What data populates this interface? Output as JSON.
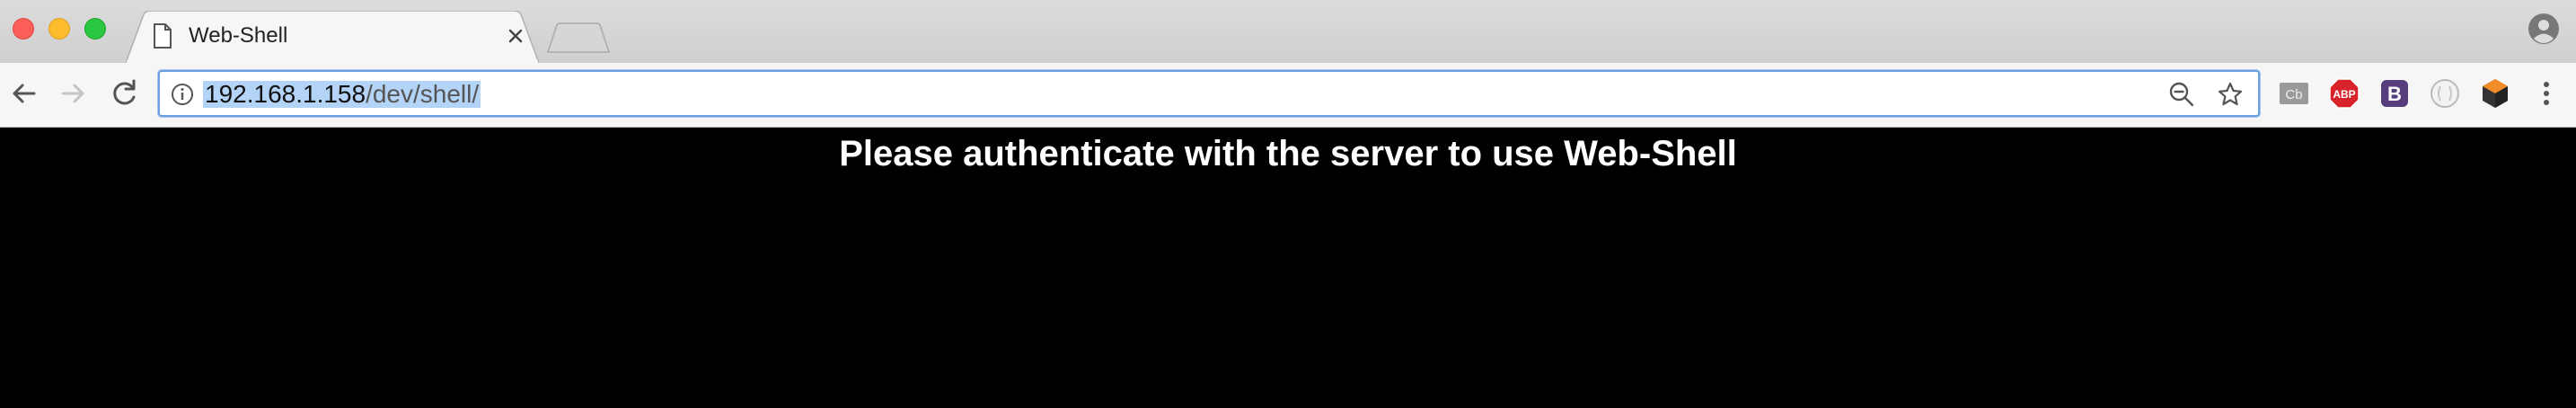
{
  "window": {
    "controls": [
      "close",
      "minimize",
      "maximize"
    ]
  },
  "tab": {
    "title": "Web-Shell",
    "icon": "document-icon"
  },
  "address_bar": {
    "host": "192.168.1.158",
    "path": "/dev/shell/",
    "selected": true,
    "security_icon": "info-icon"
  },
  "toolbar": {
    "extensions": {
      "cb": "Cb",
      "abp": "ABP",
      "bootstrap": "B"
    }
  },
  "page": {
    "message": "Please authenticate with the server to use Web-Shell",
    "background": "#000000",
    "text_color": "#ffffff"
  }
}
